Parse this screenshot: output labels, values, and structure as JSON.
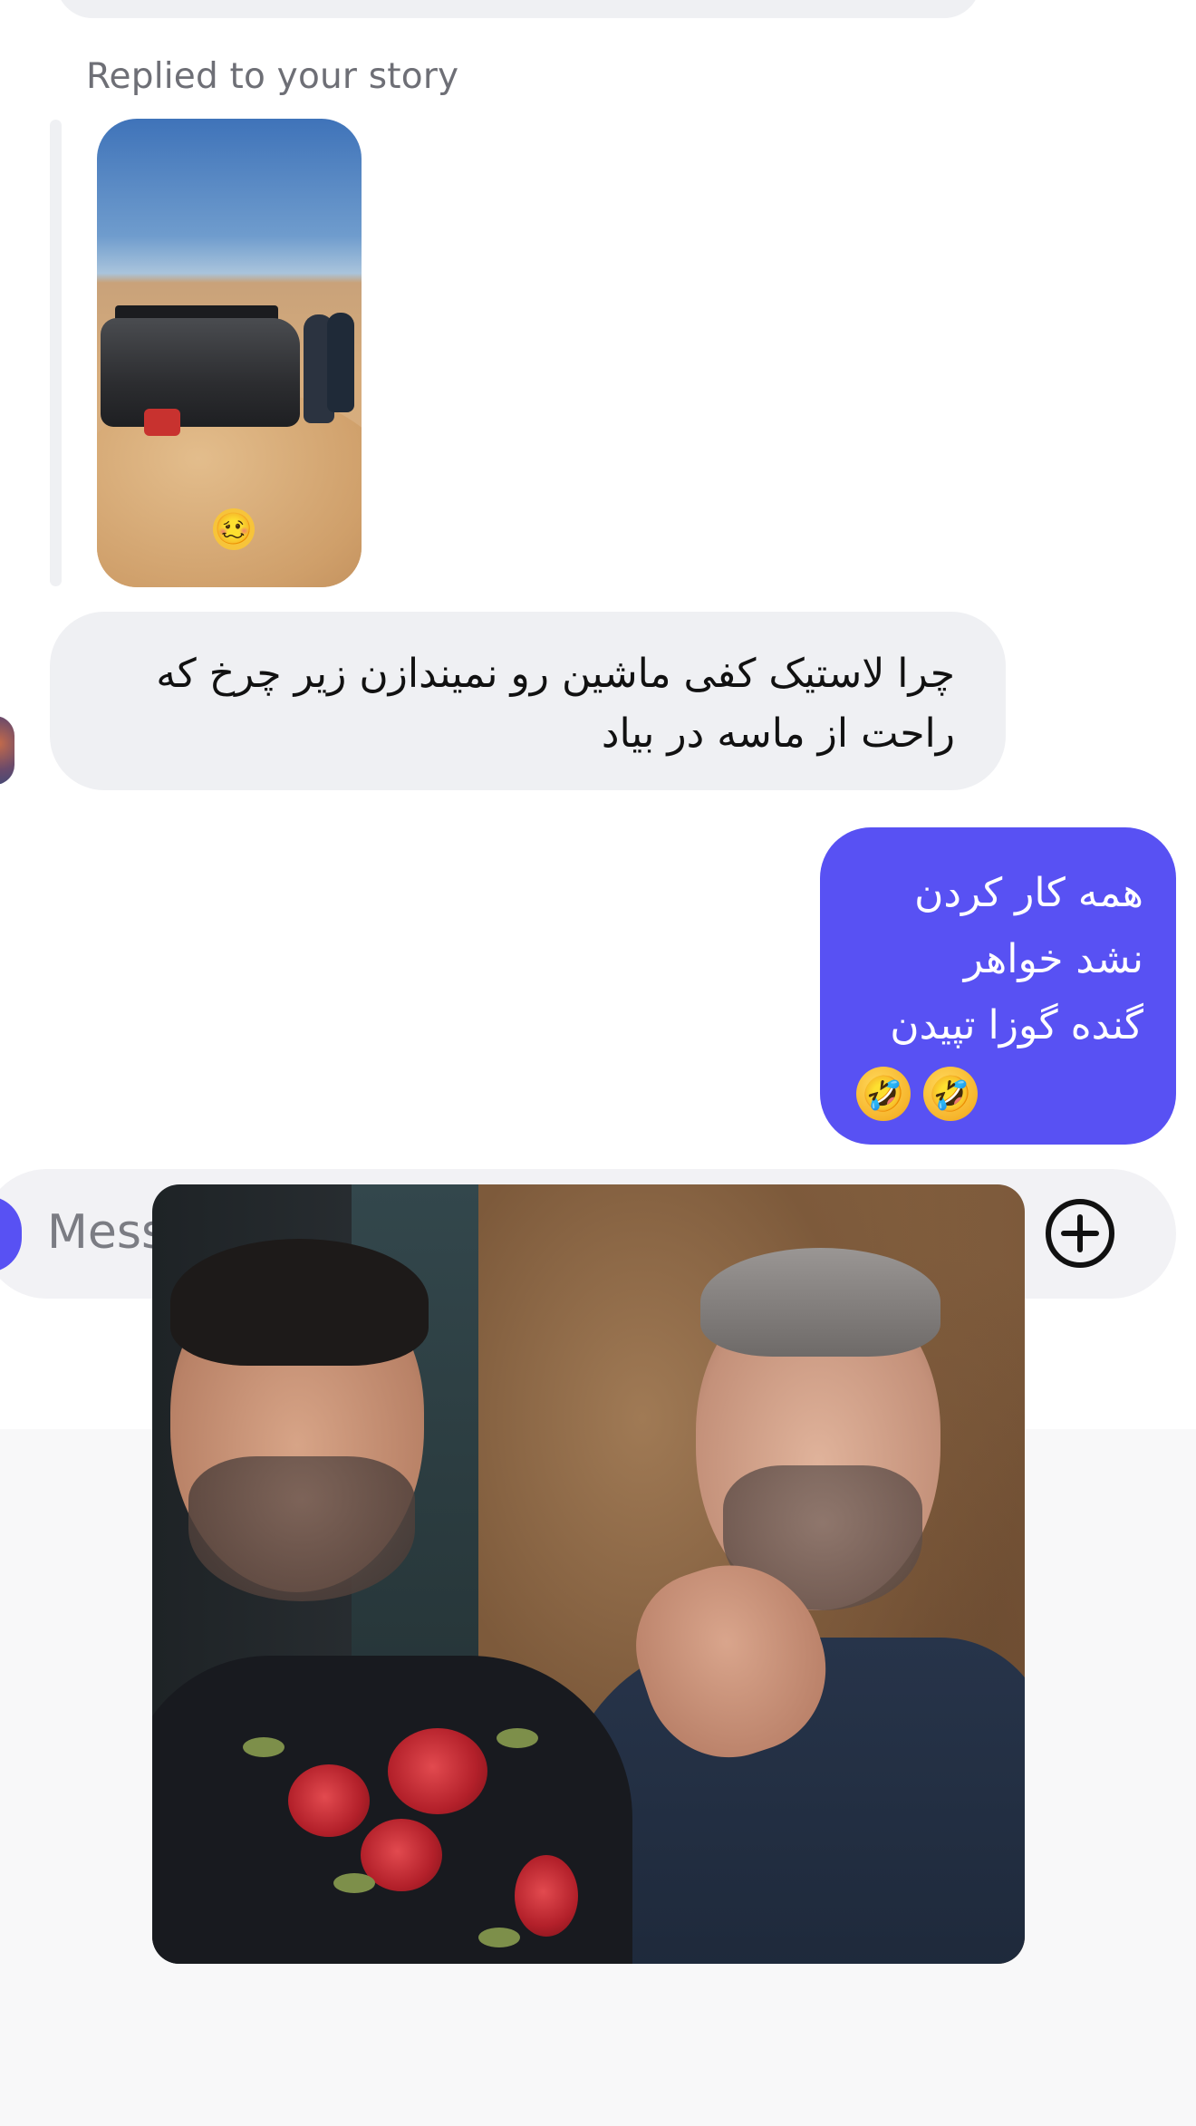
{
  "thread": {
    "story_reply_caption": "Replied to your story",
    "story_sticker_emoji": "🥴",
    "received_message": "چرا لاستیک کفی ماشین رو نمیندازن زیر چرخ که راحت از ماسه در بیاد",
    "sent_message_lines": [
      "همه کار کردن",
      "نشد خواهر",
      "گنده گوزا تپیدن"
    ],
    "sent_message_emoji": "🤣"
  },
  "composer": {
    "placeholder": "Message"
  },
  "colors": {
    "sent_bubble": "#5851f3",
    "received_bubble": "#eff0f3",
    "caption_text": "#6e6f76"
  },
  "icons": {
    "add": "plus-circle-icon"
  }
}
